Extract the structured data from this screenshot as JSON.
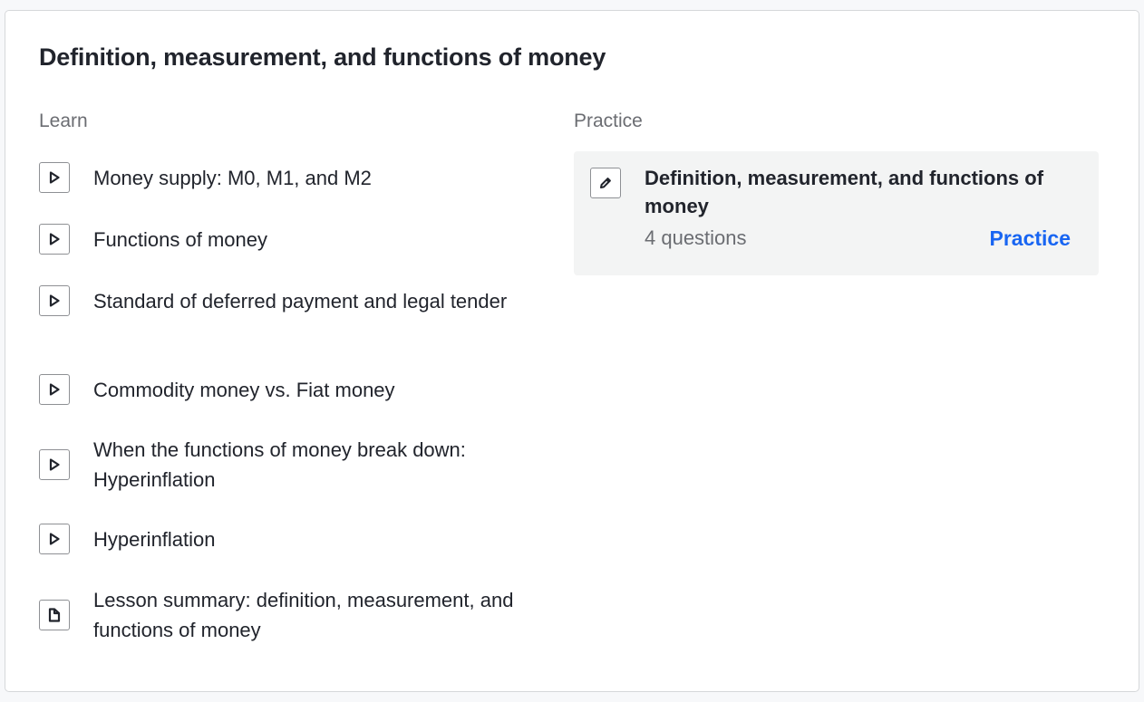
{
  "unit": {
    "title": "Definition, measurement, and functions of money"
  },
  "learn": {
    "heading": "Learn",
    "items": [
      {
        "label": "Money supply: M0, M1, and M2",
        "icon": "play-icon"
      },
      {
        "label": "Functions of money",
        "icon": "play-icon"
      },
      {
        "label": "Standard of deferred payment and legal tender",
        "icon": "play-icon"
      },
      {
        "label": "Commodity money vs. Fiat money",
        "icon": "play-icon"
      },
      {
        "label": "When the functions of money break down: Hyperinflation",
        "icon": "play-icon"
      },
      {
        "label": "Hyperinflation",
        "icon": "play-icon"
      },
      {
        "label": "Lesson summary: definition, measurement, and functions of money",
        "icon": "article-icon"
      }
    ]
  },
  "practice": {
    "heading": "Practice",
    "exercise": {
      "title": "Definition, measurement, and functions of money",
      "count": "4 questions",
      "action_label": "Practice",
      "icon": "pencil-icon"
    }
  },
  "colors": {
    "accent": "#1865f2",
    "card_bg": "#f3f4f4",
    "text": "#21242c",
    "muted": "#6b6d72"
  }
}
